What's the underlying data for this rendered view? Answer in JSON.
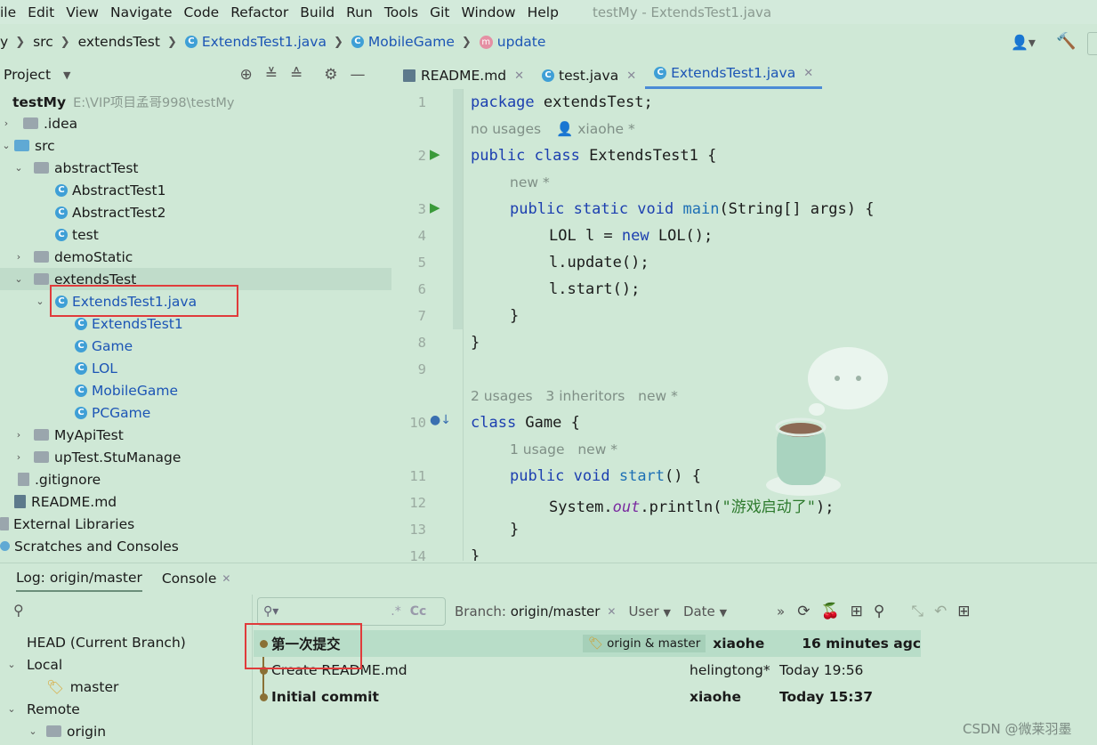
{
  "menu": [
    "ile",
    "Edit",
    "View",
    "Navigate",
    "Code",
    "Refactor",
    "Build",
    "Run",
    "Tools",
    "Git",
    "Window",
    "Help"
  ],
  "window_title": "testMy - ExtendsTest1.java",
  "breadcrumb": {
    "b0": "y",
    "b1": "src",
    "b2": "extendsTest",
    "b3": "ExtendsTest1.java",
    "b4": "MobileGame",
    "b5": "update"
  },
  "project": {
    "title": "Project",
    "tree": [
      {
        "label": "testMy",
        "extra": "E:\\VIP项目孟哥998\\testMy"
      },
      {
        "label": ".idea"
      },
      {
        "label": "src"
      },
      {
        "label": "abstractTest"
      },
      {
        "label": "AbstractTest1"
      },
      {
        "label": "AbstractTest2"
      },
      {
        "label": "test"
      },
      {
        "label": "demoStatic"
      },
      {
        "label": "extendsTest"
      },
      {
        "label": "ExtendsTest1.java"
      },
      {
        "label": "ExtendsTest1"
      },
      {
        "label": "Game"
      },
      {
        "label": "LOL"
      },
      {
        "label": "MobileGame"
      },
      {
        "label": "PCGame"
      },
      {
        "label": "MyApiTest"
      },
      {
        "label": "upTest.StuManage"
      },
      {
        "label": ".gitignore"
      },
      {
        "label": "README.md"
      },
      {
        "label": "External Libraries"
      },
      {
        "label": "Scratches and Consoles"
      }
    ]
  },
  "tabs": [
    "README.md",
    "test.java",
    "ExtendsTest1.java"
  ],
  "editor": {
    "line_numbers": [
      "1",
      "2",
      "3",
      "4",
      "5",
      "6",
      "7",
      "8",
      "9",
      "10",
      "11",
      "12",
      "13",
      "14"
    ],
    "l1a": "package",
    "l1b": " extendsTest;",
    "h1a": "no usages",
    "h1b": "xiaohe *",
    "l2a": "public class",
    "l2b": " ExtendsTest1 {",
    "h2": "new *",
    "l3a": "public static void",
    "l3b": "main",
    "l3c": "(String[] args) {",
    "l4a": "LOL l = ",
    "l4b": "new",
    "l4c": " LOL();",
    "l5": "l.update();",
    "l6": "l.start();",
    "l7": "}",
    "l8": "}",
    "h3": "2 usages   3 inheritors   new *",
    "l10a": "class",
    "l10b": " Game {",
    "h4": "1 usage   new *",
    "l11a": "public void",
    "l11b": "start",
    "l11c": "() {",
    "l12a": "System.",
    "l12b": "out",
    "l12c": ".println(",
    "l12d": "\"游戏启动了\"",
    "l12e": ");",
    "l13": "}",
    "l14": "}"
  },
  "bottom": {
    "tab_log": "Log: origin/master",
    "tab_console": "Console",
    "branch_label": "Branch:",
    "branch_value": "origin/master",
    "user_filter": "User",
    "date_filter": "Date",
    "cc": "Cc"
  },
  "branches": {
    "head": "HEAD (Current Branch)",
    "local": "Local",
    "master": "master",
    "remote": "Remote",
    "origin": "origin"
  },
  "commits": [
    {
      "msg": "第一次提交",
      "tag": "origin & master",
      "author": "xiaohe",
      "date": "16 minutes agc"
    },
    {
      "msg": "Create README.md",
      "author": "helingtong*",
      "date": "Today 19:56"
    },
    {
      "msg": "Initial commit",
      "author": "xiaohe",
      "date": "Today 15:37"
    }
  ],
  "watermark": "CSDN @微莱羽墨"
}
